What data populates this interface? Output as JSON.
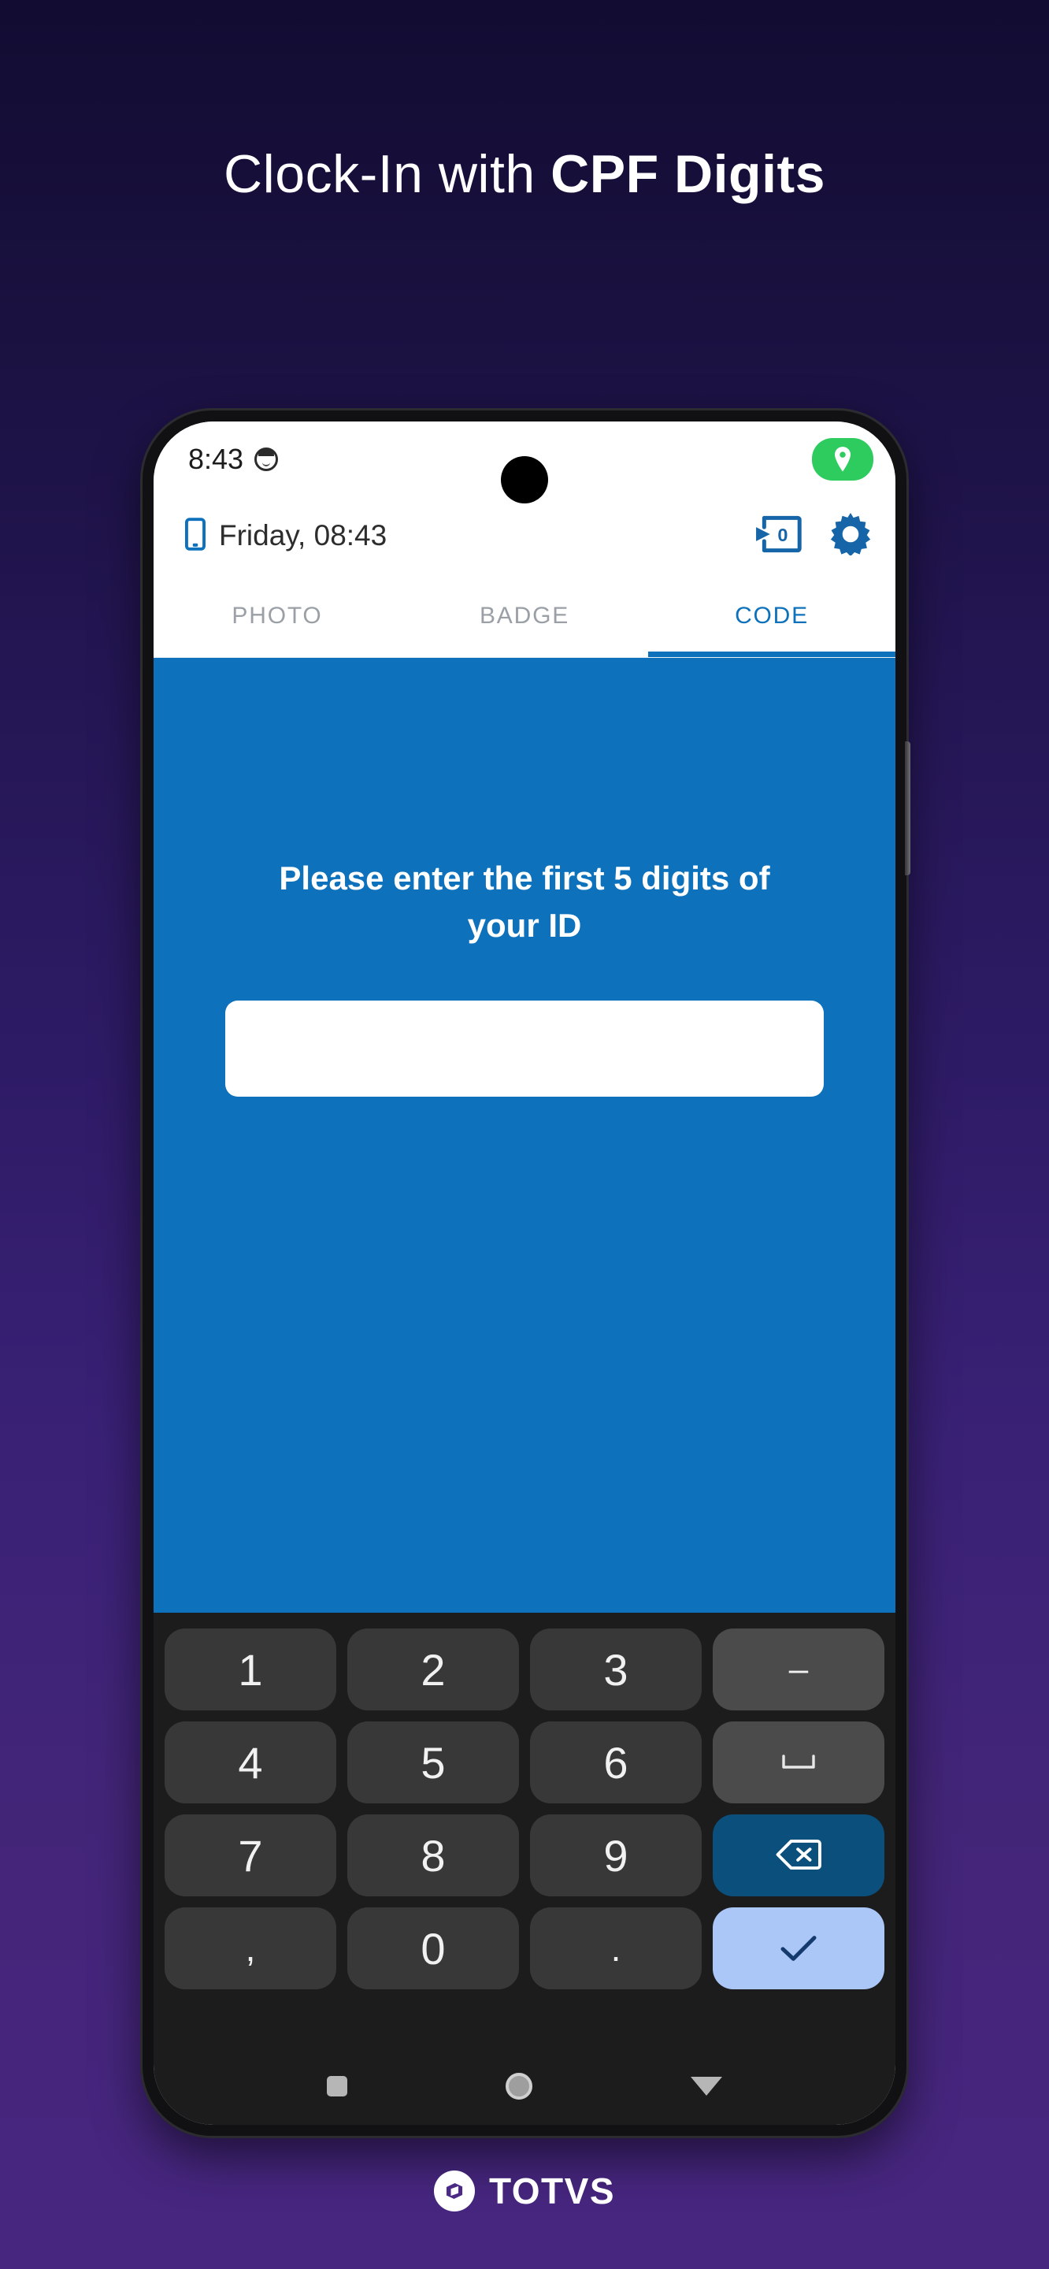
{
  "hero": {
    "title_light": "Clock-In with ",
    "title_bold": "CPF Digits"
  },
  "phone": {
    "statusbar": {
      "time": "8:43",
      "face_icon": "face-icon",
      "location_icon": "location-pin-icon"
    },
    "app_header": {
      "device_icon": "mobile-phone-icon",
      "date": "Friday, 08:43",
      "sync_icon": "pending-records-icon",
      "sync_badge": "0",
      "settings_icon": "gear-icon"
    },
    "tabs": [
      {
        "label": "PHOTO",
        "active": false
      },
      {
        "label": "BADGE",
        "active": false
      },
      {
        "label": "CODE",
        "active": true
      }
    ],
    "content": {
      "prompt": "Please enter the first 5 digits of your ID",
      "input_value": "",
      "input_placeholder": ""
    },
    "keyboard": {
      "rows": [
        [
          {
            "label": "1",
            "type": "num",
            "name": "key-1"
          },
          {
            "label": "2",
            "type": "num",
            "name": "key-2"
          },
          {
            "label": "3",
            "type": "num",
            "name": "key-3"
          },
          {
            "label": "–",
            "type": "fn",
            "name": "key-dash"
          }
        ],
        [
          {
            "label": "4",
            "type": "num",
            "name": "key-4"
          },
          {
            "label": "5",
            "type": "num",
            "name": "key-5"
          },
          {
            "label": "6",
            "type": "num",
            "name": "key-6"
          },
          {
            "label": "⌴",
            "type": "fn",
            "name": "key-space"
          }
        ],
        [
          {
            "label": "7",
            "type": "num",
            "name": "key-7"
          },
          {
            "label": "8",
            "type": "num",
            "name": "key-8"
          },
          {
            "label": "9",
            "type": "num",
            "name": "key-9"
          },
          {
            "label": "",
            "type": "back",
            "name": "key-backspace"
          }
        ],
        [
          {
            "label": ",",
            "type": "sym",
            "name": "key-comma"
          },
          {
            "label": "0",
            "type": "num",
            "name": "key-0"
          },
          {
            "label": ".",
            "type": "sym",
            "name": "key-period"
          },
          {
            "label": "",
            "type": "enter",
            "name": "key-enter"
          }
        ]
      ]
    },
    "navbar": {
      "recents_icon": "square-recents-icon",
      "home_icon": "circle-home-icon",
      "back_icon": "triangle-down-back-icon"
    }
  },
  "brand": {
    "mark_icon": "totvs-logo-icon",
    "name": "TOTVS"
  },
  "colors": {
    "accent_blue": "#0d71bb",
    "bg_top": "#120c32",
    "bg_bottom": "#472680",
    "status_green": "#2ecc5f",
    "key_bg": "#383838",
    "key_fn_bg": "#4b4b4b",
    "key_back_bg": "#0b4f7d",
    "key_enter_bg": "#aac7f7"
  }
}
